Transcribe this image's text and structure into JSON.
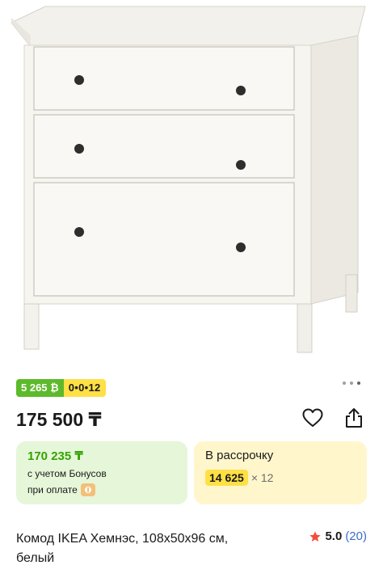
{
  "product": {
    "image_alt": "Комод IKEA Хемнэс белый",
    "title": "Комод IKEA Хемнэс, 108x50x96 см, белый",
    "price": "175 500 ₸",
    "badges": {
      "bonus_amount": "5 265 ₿",
      "installment_plan": "0•0•12"
    },
    "rating": {
      "value": "5.0",
      "count": "(20)"
    }
  },
  "bonus_card": {
    "price": "170 235 ₸",
    "line1": "с учетом Бонусов",
    "line2": "при оплате"
  },
  "installment_card": {
    "title": "В рассрочку",
    "amount": "14 625",
    "months": "× 12"
  },
  "carousel": {
    "dots": 3,
    "active_index": 2
  },
  "colors": {
    "bonus_green": "#5cba2b",
    "yellow": "#ffe045",
    "link_blue": "#3c6ecb",
    "star_red": "#f04f3b"
  }
}
